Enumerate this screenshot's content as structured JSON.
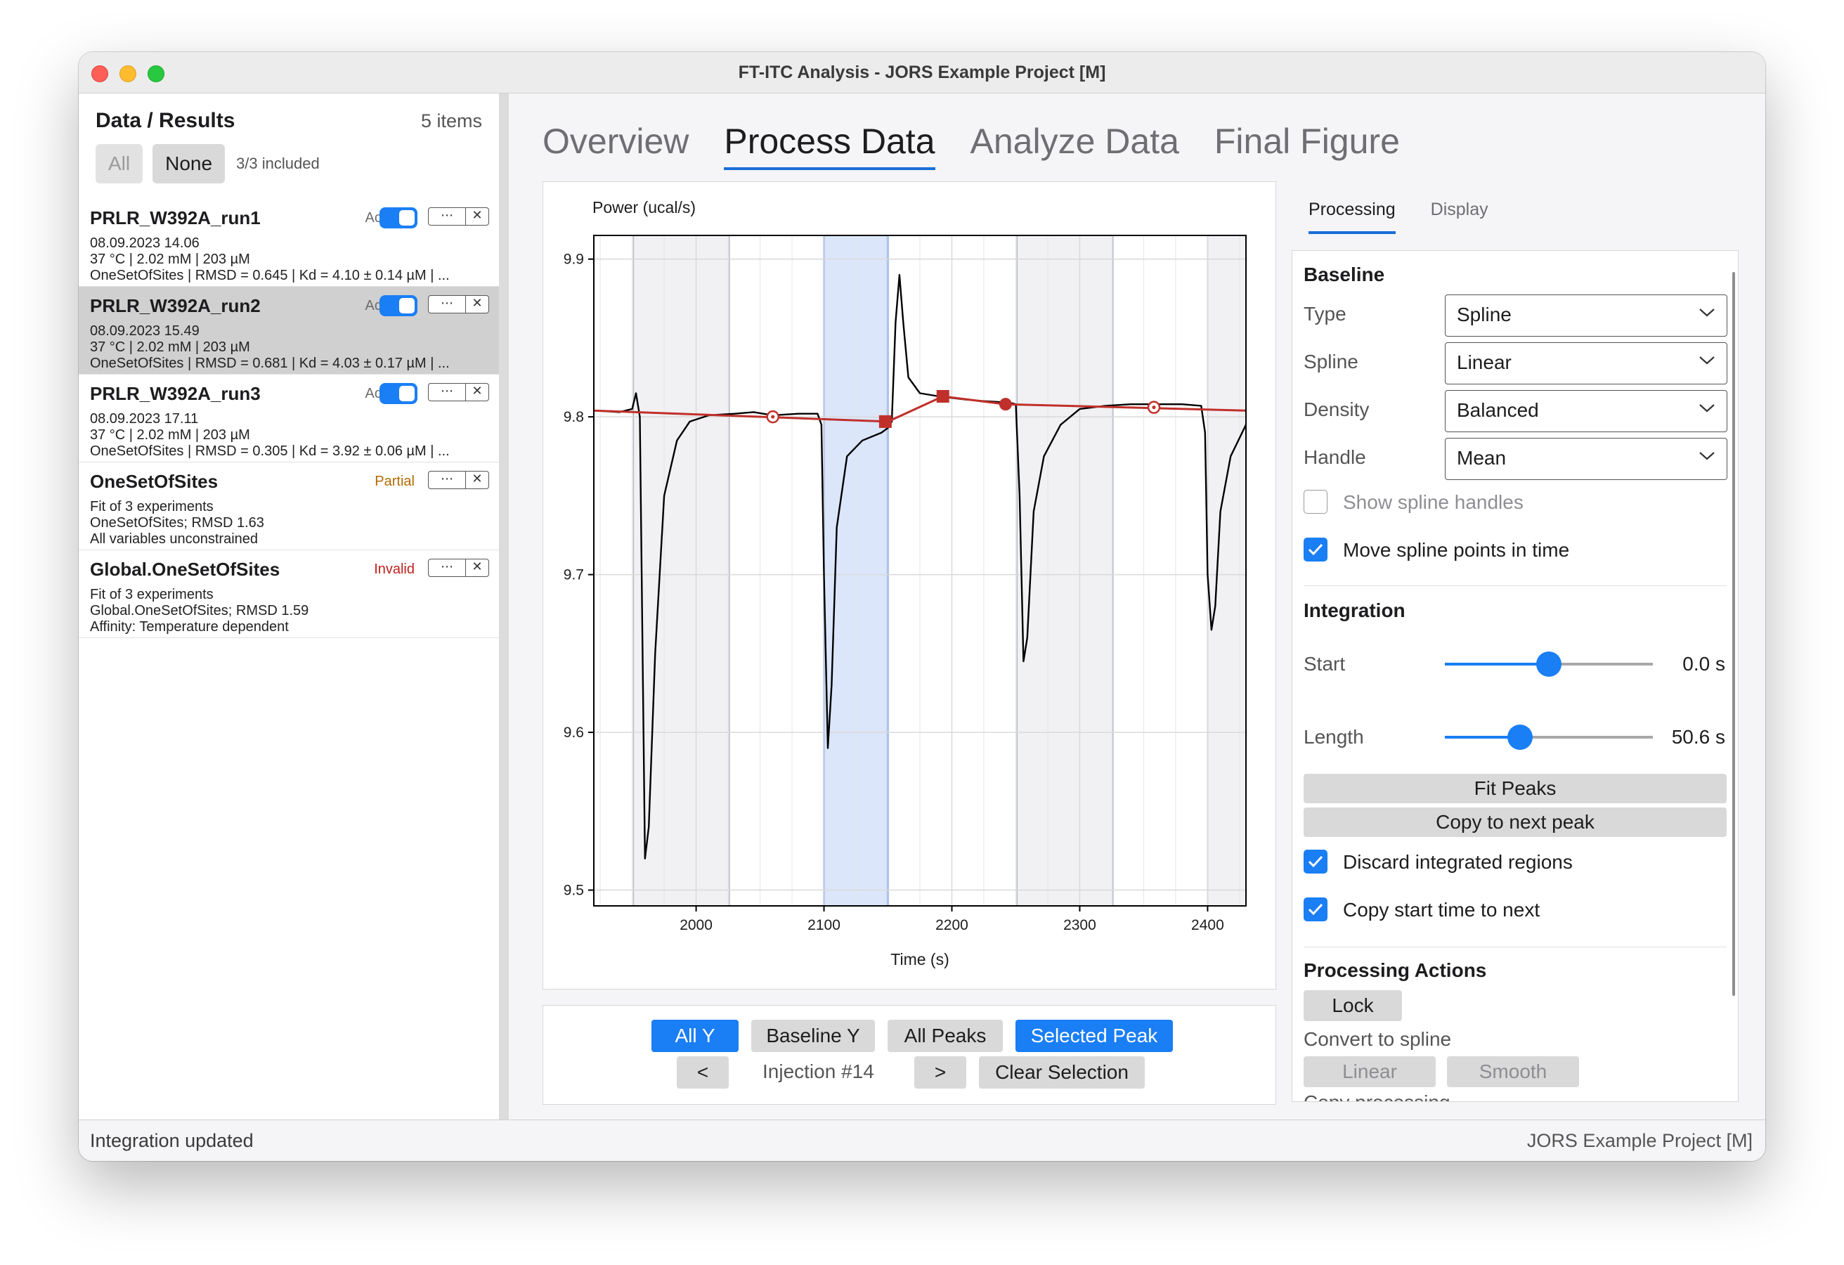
{
  "window": {
    "title": "FT-ITC Analysis - JORS Example Project [M]"
  },
  "left": {
    "title": "Data / Results",
    "count": "5 items",
    "btn_all": "All",
    "btn_none": "None",
    "included": "3/3 included",
    "items": [
      {
        "name": "PRLR_W392A_run1",
        "status": "Active",
        "line1": "08.09.2023 14.06",
        "line2": "37 °C | 2.02 mM | 203 µM",
        "line3": "OneSetOfSites | RMSD = 0.645 | Kd = 4.10 ± 0.14 µM | ..."
      },
      {
        "name": "PRLR_W392A_run2",
        "status": "Active",
        "line1": "08.09.2023 15.49",
        "line2": "37 °C | 2.02 mM | 203 µM",
        "line3": "OneSetOfSites | RMSD = 0.681 | Kd = 4.03 ± 0.17 µM | ..."
      },
      {
        "name": "PRLR_W392A_run3",
        "status": "Active",
        "line1": "08.09.2023 17.11",
        "line2": "37 °C | 2.02 mM | 203 µM",
        "line3": "OneSetOfSites | RMSD = 0.305 | Kd = 3.92 ± 0.06 µM | ..."
      },
      {
        "name": "OneSetOfSites",
        "status": "Partial",
        "line1": "Fit of 3 experiments",
        "line2": "OneSetOfSites; RMSD 1.63",
        "line3": "All variables unconstrained"
      },
      {
        "name": "Global.OneSetOfSites",
        "status": "Invalid",
        "line1": "Fit of 3 experiments",
        "line2": "Global.OneSetOfSites; RMSD 1.59",
        "line3": "Affinity: Temperature dependent"
      }
    ]
  },
  "tabs": [
    "Overview",
    "Process Data",
    "Analyze Data",
    "Final Figure"
  ],
  "chart_data": {
    "type": "line",
    "title": "",
    "xlabel": "Time (s)",
    "ylabel": "Power (ucal/s)",
    "xlim": [
      1920,
      2430
    ],
    "ylim": [
      9.49,
      9.915
    ],
    "xticks": [
      2000,
      2100,
      2200,
      2300,
      2400
    ],
    "yticks": [
      9.5,
      9.6,
      9.7,
      9.8,
      9.9
    ],
    "grid": true,
    "series": [
      {
        "role": "signal",
        "color": "#000000",
        "points": [
          [
            1920,
            9.804
          ],
          [
            1940,
            9.803
          ],
          [
            1950,
            9.805
          ],
          [
            1953,
            9.815
          ],
          [
            1956,
            9.8
          ],
          [
            1960,
            9.52
          ],
          [
            1963,
            9.54
          ],
          [
            1968,
            9.65
          ],
          [
            1975,
            9.75
          ],
          [
            1985,
            9.785
          ],
          [
            1995,
            9.797
          ],
          [
            2010,
            9.801
          ],
          [
            2030,
            9.802
          ],
          [
            2045,
            9.803
          ],
          [
            2060,
            9.801
          ],
          [
            2080,
            9.802
          ],
          [
            2095,
            9.802
          ],
          [
            2098,
            9.795
          ],
          [
            2100,
            9.7
          ],
          [
            2103,
            9.59
          ],
          [
            2106,
            9.63
          ],
          [
            2110,
            9.73
          ],
          [
            2118,
            9.775
          ],
          [
            2130,
            9.785
          ],
          [
            2145,
            9.79
          ],
          [
            2150,
            9.793
          ],
          [
            2153,
            9.797
          ],
          [
            2156,
            9.86
          ],
          [
            2159,
            9.89
          ],
          [
            2162,
            9.86
          ],
          [
            2166,
            9.825
          ],
          [
            2175,
            9.815
          ],
          [
            2190,
            9.813
          ],
          [
            2210,
            9.811
          ],
          [
            2225,
            9.81
          ],
          [
            2245,
            9.809
          ],
          [
            2250,
            9.808
          ],
          [
            2253,
            9.75
          ],
          [
            2256,
            9.645
          ],
          [
            2259,
            9.66
          ],
          [
            2264,
            9.74
          ],
          [
            2272,
            9.775
          ],
          [
            2285,
            9.795
          ],
          [
            2300,
            9.805
          ],
          [
            2320,
            9.807
          ],
          [
            2340,
            9.808
          ],
          [
            2360,
            9.808
          ],
          [
            2380,
            9.808
          ],
          [
            2395,
            9.807
          ],
          [
            2398,
            9.79
          ],
          [
            2400,
            9.7
          ],
          [
            2403,
            9.665
          ],
          [
            2406,
            9.68
          ],
          [
            2410,
            9.74
          ],
          [
            2418,
            9.775
          ],
          [
            2430,
            9.795
          ]
        ]
      },
      {
        "role": "baseline",
        "color": "#c0302b",
        "points": [
          [
            1920,
            9.804
          ],
          [
            2150,
            9.797
          ],
          [
            2193,
            9.813
          ],
          [
            2242,
            9.808
          ],
          [
            2430,
            9.804
          ]
        ]
      }
    ],
    "markers": [
      {
        "x": 2060,
        "y": 9.8,
        "shape": "ring"
      },
      {
        "x": 2148,
        "y": 9.797,
        "shape": "square"
      },
      {
        "x": 2193,
        "y": 9.813,
        "shape": "square"
      },
      {
        "x": 2242,
        "y": 9.808,
        "shape": "dot"
      },
      {
        "x": 2358,
        "y": 9.806,
        "shape": "ring"
      }
    ],
    "regions": [
      {
        "x0": 1951,
        "x1": 2026,
        "kind": "peak"
      },
      {
        "x0": 2100,
        "x1": 2150,
        "kind": "selected"
      },
      {
        "x0": 2251,
        "x1": 2326,
        "kind": "peak"
      },
      {
        "x0": 2400,
        "x1": 2430,
        "kind": "peak"
      }
    ]
  },
  "bottom": {
    "all_y": "All Y",
    "baseline_y": "Baseline Y",
    "all_peaks": "All Peaks",
    "selected_peak": "Selected Peak",
    "prev": "<",
    "injection": "Injection #14",
    "next": ">",
    "clear": "Clear Selection"
  },
  "right": {
    "tab_processing": "Processing",
    "tab_display": "Display",
    "baseline_title": "Baseline",
    "type_label": "Type",
    "type_value": "Spline",
    "spline_label": "Spline",
    "spline_value": "Linear",
    "density_label": "Density",
    "density_value": "Balanced",
    "handle_label": "Handle",
    "handle_value": "Mean",
    "show_handles": "Show spline handles",
    "move_points": "Move spline points in time",
    "integration_title": "Integration",
    "start_label": "Start",
    "start_value": "0.0 s",
    "start_level": 0.5,
    "length_label": "Length",
    "length_value": "50.6 s",
    "length_level": 0.36,
    "fit_peaks": "Fit Peaks",
    "copy_next": "Copy to next peak",
    "discard": "Discard integrated regions",
    "copy_start": "Copy start time to next",
    "actions_title": "Processing Actions",
    "lock": "Lock",
    "convert": "Convert to spline",
    "linear": "Linear",
    "smooth": "Smooth",
    "copy_processing": "Copy processing"
  },
  "status": {
    "left": "Integration updated",
    "right": "JORS Example Project [M]"
  }
}
